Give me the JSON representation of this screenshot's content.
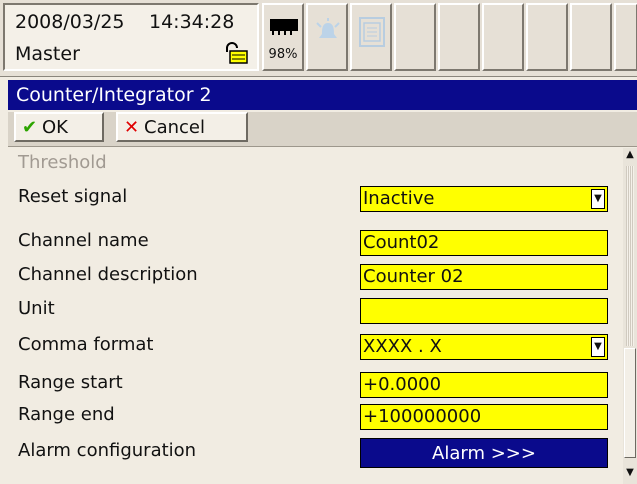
{
  "status": {
    "date": "2008/03/25",
    "time": "14:34:28",
    "user": "Master",
    "memory_pct": "98%",
    "icons": [
      "lock-icon",
      "memory-card-icon",
      "alarm-bell-icon",
      "memory-save-icon"
    ]
  },
  "dialog": {
    "title": "Counter/Integrator 2",
    "ok_label": "OK",
    "cancel_label": "Cancel"
  },
  "form": {
    "section": "Threshold",
    "fields": [
      {
        "label": "Reset signal",
        "value": "Inactive",
        "type": "dropdown"
      },
      {
        "label": "Channel name",
        "value": "Count02",
        "type": "text"
      },
      {
        "label": "Channel description",
        "value": "Counter 02",
        "type": "text"
      },
      {
        "label": "Unit",
        "value": "",
        "type": "text"
      },
      {
        "label": "Comma format",
        "value": "XXXX . X",
        "type": "dropdown"
      },
      {
        "label": "Range start",
        "value": "+0.0000",
        "type": "text"
      },
      {
        "label": "Range end",
        "value": "+100000000",
        "type": "text"
      },
      {
        "label": "Alarm configuration",
        "value": "Alarm >>>",
        "type": "button"
      }
    ]
  },
  "colors": {
    "titlebar": "#0a0a8c",
    "field_bg": "#ffff00",
    "ok_check": "#2ca400",
    "cancel_x": "#e00000"
  }
}
